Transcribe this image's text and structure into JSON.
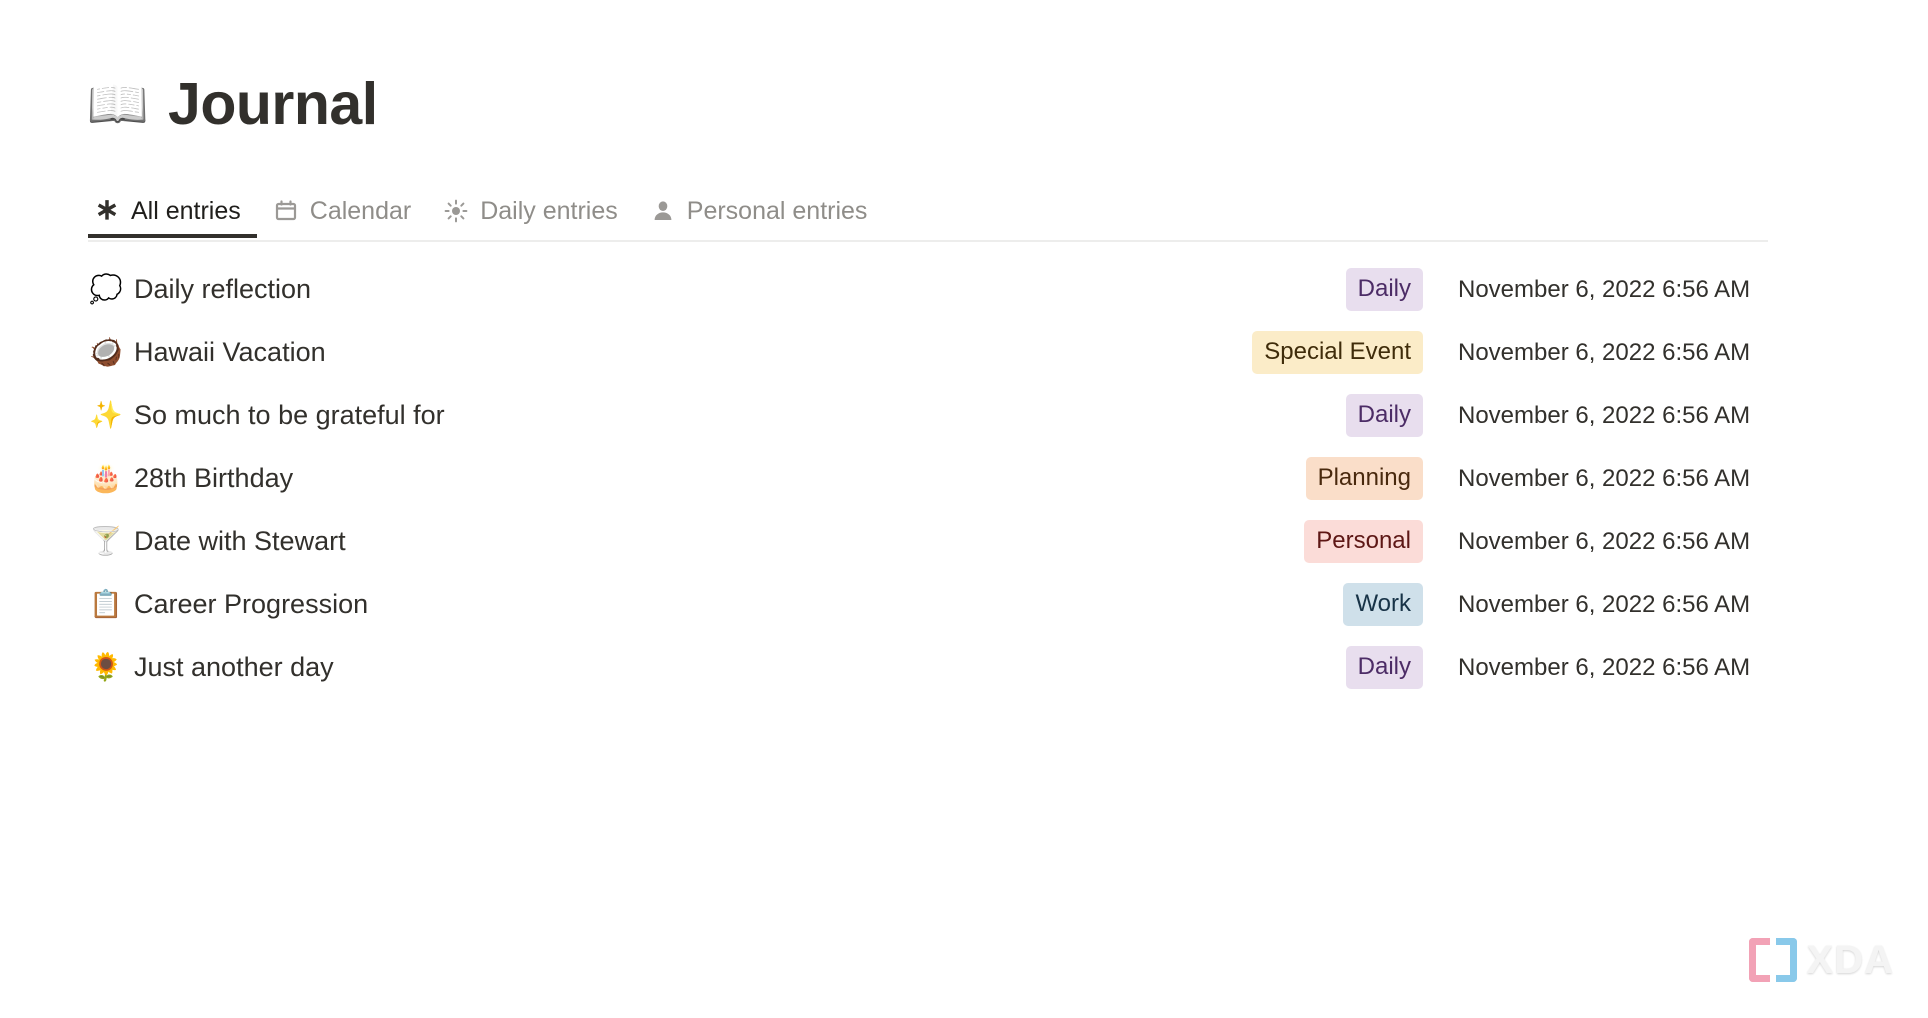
{
  "header": {
    "emoji": "📖",
    "emoji_name": "open-book-emoji",
    "title": "Journal"
  },
  "tabs": [
    {
      "label": "All entries",
      "icon": "asterisk-icon",
      "active": true
    },
    {
      "label": "Calendar",
      "icon": "calendar-icon",
      "active": false
    },
    {
      "label": "Daily entries",
      "icon": "sun-icon",
      "active": false
    },
    {
      "label": "Personal entries",
      "icon": "person-icon",
      "active": false
    }
  ],
  "entries": [
    {
      "emoji": "💭",
      "emoji_name": "thought-balloon-emoji",
      "title": "Daily reflection",
      "tag": "Daily",
      "tag_bg": "#e8deee",
      "tag_fg": "#4c2c66",
      "date": "November 6, 2022 6:56 AM"
    },
    {
      "emoji": "🥥",
      "emoji_name": "coconut-emoji",
      "title": "Hawaii Vacation",
      "tag": "Special Event",
      "tag_bg": "#fbecc8",
      "tag_fg": "#3f2c0a",
      "date": "November 6, 2022 6:56 AM"
    },
    {
      "emoji": "✨",
      "emoji_name": "sparkles-emoji",
      "title": "So much to be grateful for",
      "tag": "Daily",
      "tag_bg": "#e8deee",
      "tag_fg": "#4c2c66",
      "date": "November 6, 2022 6:56 AM"
    },
    {
      "emoji": "🎂",
      "emoji_name": "birthday-cake-emoji",
      "title": "28th Birthday",
      "tag": "Planning",
      "tag_bg": "#fadec9",
      "tag_fg": "#49290e",
      "date": "November 6, 2022 6:56 AM"
    },
    {
      "emoji": "🍸",
      "emoji_name": "cocktail-glass-emoji",
      "title": "Date with Stewart",
      "tag": "Personal",
      "tag_bg": "#fbdcd8",
      "tag_fg": "#5d1715",
      "date": "November 6, 2022 6:56 AM"
    },
    {
      "emoji": "📋",
      "emoji_name": "clipboard-emoji",
      "title": "Career Progression",
      "tag": "Work",
      "tag_bg": "#cfe0ea",
      "tag_fg": "#183347",
      "date": "November 6, 2022 6:56 AM"
    },
    {
      "emoji": "🌻",
      "emoji_name": "sunflower-emoji",
      "title": "Just another day",
      "tag": "Daily",
      "tag_bg": "#e8deee",
      "tag_fg": "#4c2c66",
      "date": "November 6, 2022 6:56 AM"
    }
  ],
  "watermark": {
    "text": "XDA",
    "bracket_left_color": "#f2a0b4",
    "bracket_right_color": "#86c8ea"
  }
}
